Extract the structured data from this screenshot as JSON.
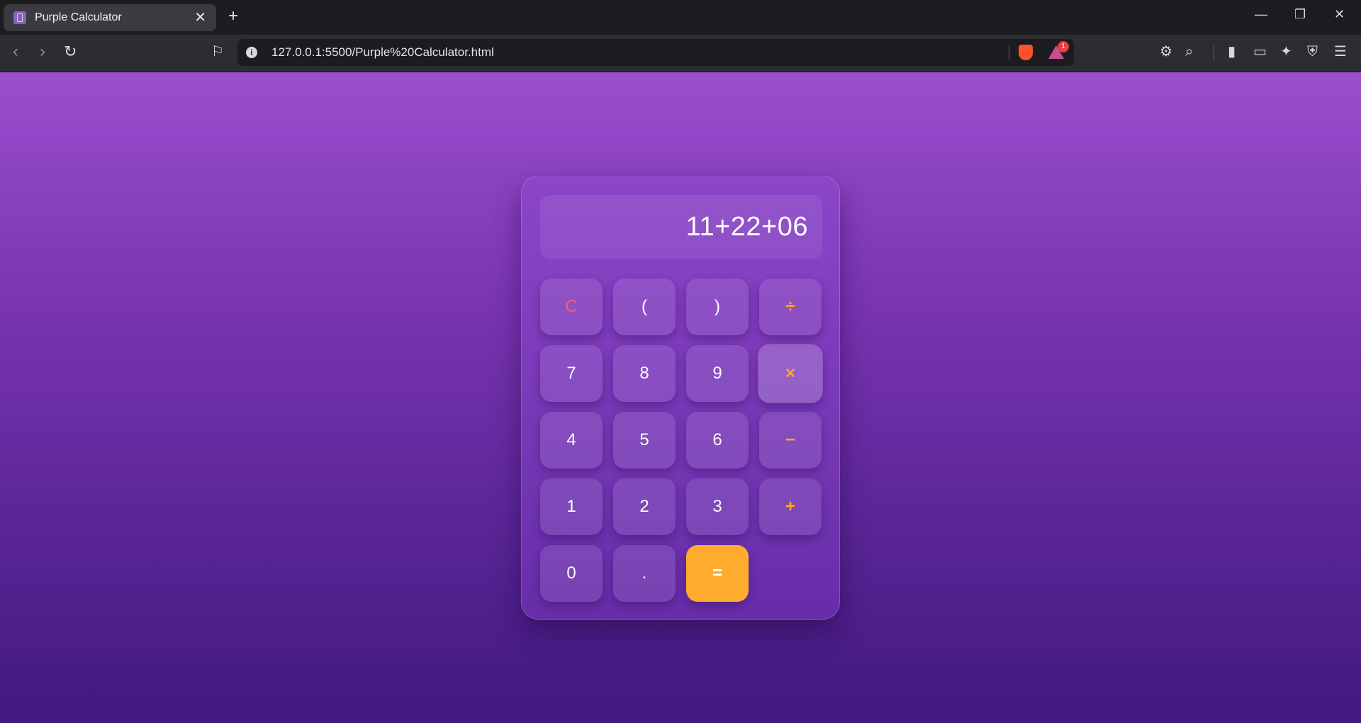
{
  "browser": {
    "tab_title": "Purple Calculator",
    "url": "127.0.0.1:5500/Purple%20Calculator.html",
    "rewards_badge": "1"
  },
  "calculator": {
    "display": "11+22+06",
    "keys": [
      {
        "label": "C",
        "name": "clear-button",
        "kind": "clear"
      },
      {
        "label": "(",
        "name": "open-paren-button",
        "kind": "digit"
      },
      {
        "label": ")",
        "name": "close-paren-button",
        "kind": "digit"
      },
      {
        "label": "÷",
        "name": "divide-button",
        "kind": "op"
      },
      {
        "label": "7",
        "name": "digit-7-button",
        "kind": "digit"
      },
      {
        "label": "8",
        "name": "digit-8-button",
        "kind": "digit"
      },
      {
        "label": "9",
        "name": "digit-9-button",
        "kind": "digit"
      },
      {
        "label": "×",
        "name": "multiply-button",
        "kind": "op"
      },
      {
        "label": "4",
        "name": "digit-4-button",
        "kind": "digit"
      },
      {
        "label": "5",
        "name": "digit-5-button",
        "kind": "digit"
      },
      {
        "label": "6",
        "name": "digit-6-button",
        "kind": "digit"
      },
      {
        "label": "−",
        "name": "subtract-button",
        "kind": "op"
      },
      {
        "label": "1",
        "name": "digit-1-button",
        "kind": "digit"
      },
      {
        "label": "2",
        "name": "digit-2-button",
        "kind": "digit"
      },
      {
        "label": "3",
        "name": "digit-3-button",
        "kind": "digit"
      },
      {
        "label": "+",
        "name": "add-button",
        "kind": "op"
      },
      {
        "label": "0",
        "name": "digit-0-button",
        "kind": "digit"
      },
      {
        "label": ".",
        "name": "decimal-button",
        "kind": "digit"
      },
      {
        "label": "=",
        "name": "equals-button",
        "kind": "equals"
      }
    ]
  },
  "colors": {
    "accent_orange": "#ffab2e",
    "clear_red": "#ff5a6a",
    "background_top": "#9a4ece",
    "background_bottom": "#41197f"
  }
}
